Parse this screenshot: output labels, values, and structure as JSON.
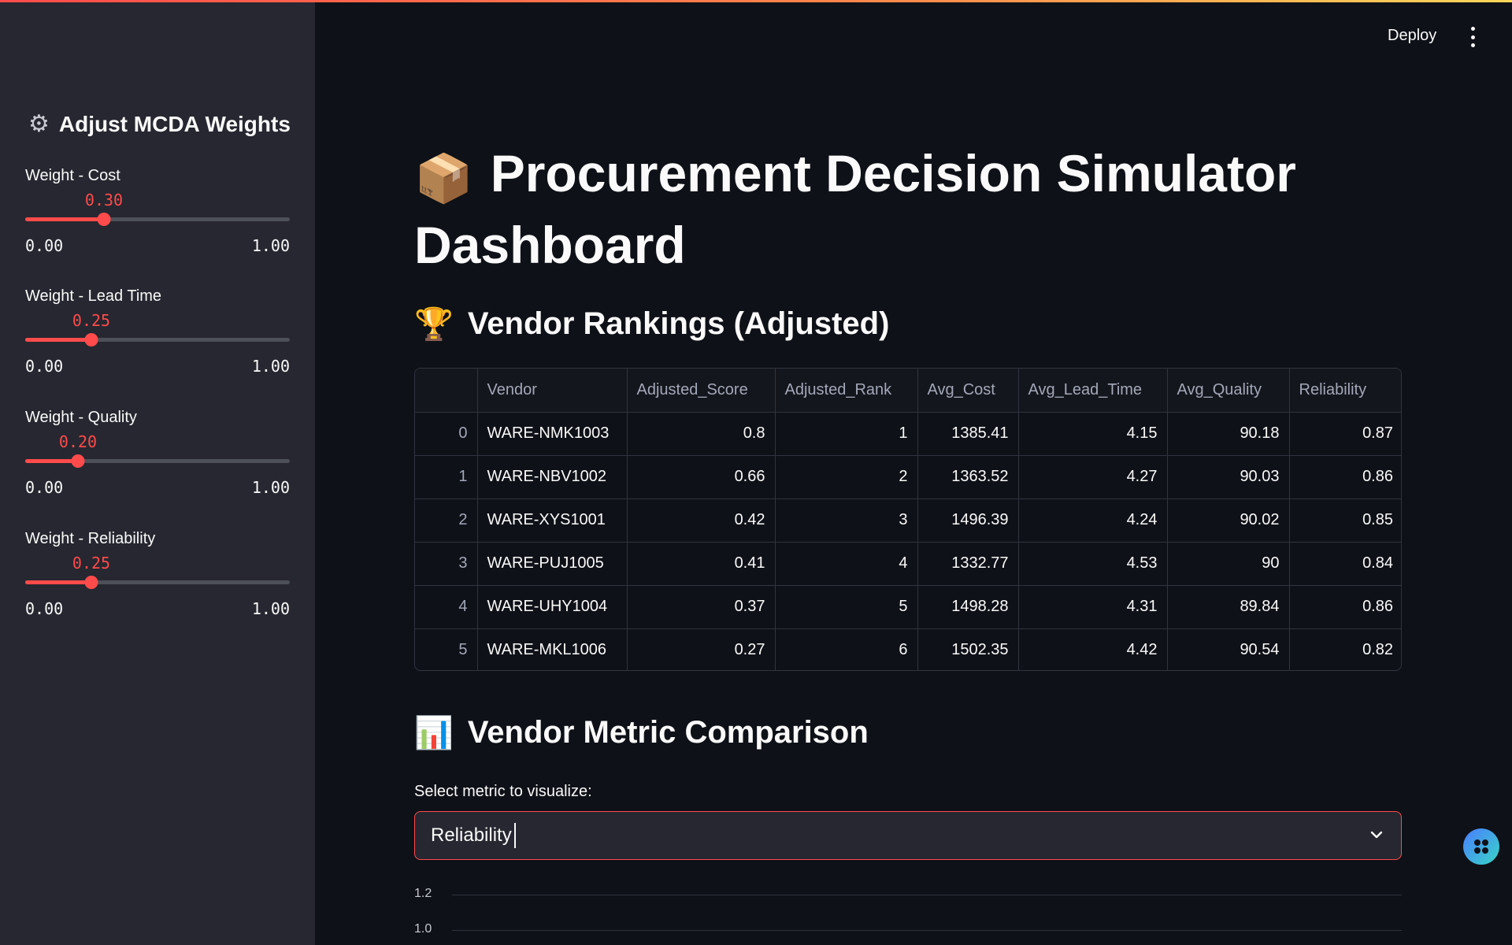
{
  "header": {
    "deploy_label": "Deploy",
    "menu_icon": "more-vertical-icon"
  },
  "sidebar": {
    "title": "Adjust MCDA Weights",
    "title_icon": "gear-icon",
    "sliders": [
      {
        "label": "Weight - Cost",
        "value": "0.30",
        "value_num": 0.3,
        "min": "0.00",
        "max": "1.00"
      },
      {
        "label": "Weight - Lead Time",
        "value": "0.25",
        "value_num": 0.25,
        "min": "0.00",
        "max": "1.00"
      },
      {
        "label": "Weight - Quality",
        "value": "0.20",
        "value_num": 0.2,
        "min": "0.00",
        "max": "1.00"
      },
      {
        "label": "Weight - Reliability",
        "value": "0.25",
        "value_num": 0.25,
        "min": "0.00",
        "max": "1.00"
      }
    ],
    "accent_color": "#ff4b4b"
  },
  "main": {
    "title": "Procurement Decision Simulator Dashboard",
    "title_icon": "package-icon",
    "rankings": {
      "heading": "Vendor Rankings (Adjusted)",
      "icon": "trophy-icon",
      "columns": [
        "",
        "Vendor",
        "Adjusted_Score",
        "Adjusted_Rank",
        "Avg_Cost",
        "Avg_Lead_Time",
        "Avg_Quality",
        "Reliability"
      ],
      "rows": [
        [
          "0",
          "WARE-NMK1003",
          "0.8",
          "1",
          "1385.41",
          "4.15",
          "90.18",
          "0.87"
        ],
        [
          "1",
          "WARE-NBV1002",
          "0.66",
          "2",
          "1363.52",
          "4.27",
          "90.03",
          "0.86"
        ],
        [
          "2",
          "WARE-XYS1001",
          "0.42",
          "3",
          "1496.39",
          "4.24",
          "90.02",
          "0.85"
        ],
        [
          "3",
          "WARE-PUJ1005",
          "0.41",
          "4",
          "1332.77",
          "4.53",
          "90",
          "0.84"
        ],
        [
          "4",
          "WARE-UHY1004",
          "0.37",
          "5",
          "1498.28",
          "4.31",
          "89.84",
          "0.86"
        ],
        [
          "5",
          "WARE-MKL1006",
          "0.27",
          "6",
          "1502.35",
          "4.42",
          "90.54",
          "0.82"
        ]
      ]
    },
    "comparison": {
      "heading": "Vendor Metric Comparison",
      "icon": "bar-chart-icon",
      "select_label": "Select metric to visualize:",
      "select_value": "Reliability",
      "y_ticks": [
        "1.2",
        "1.0"
      ]
    }
  }
}
